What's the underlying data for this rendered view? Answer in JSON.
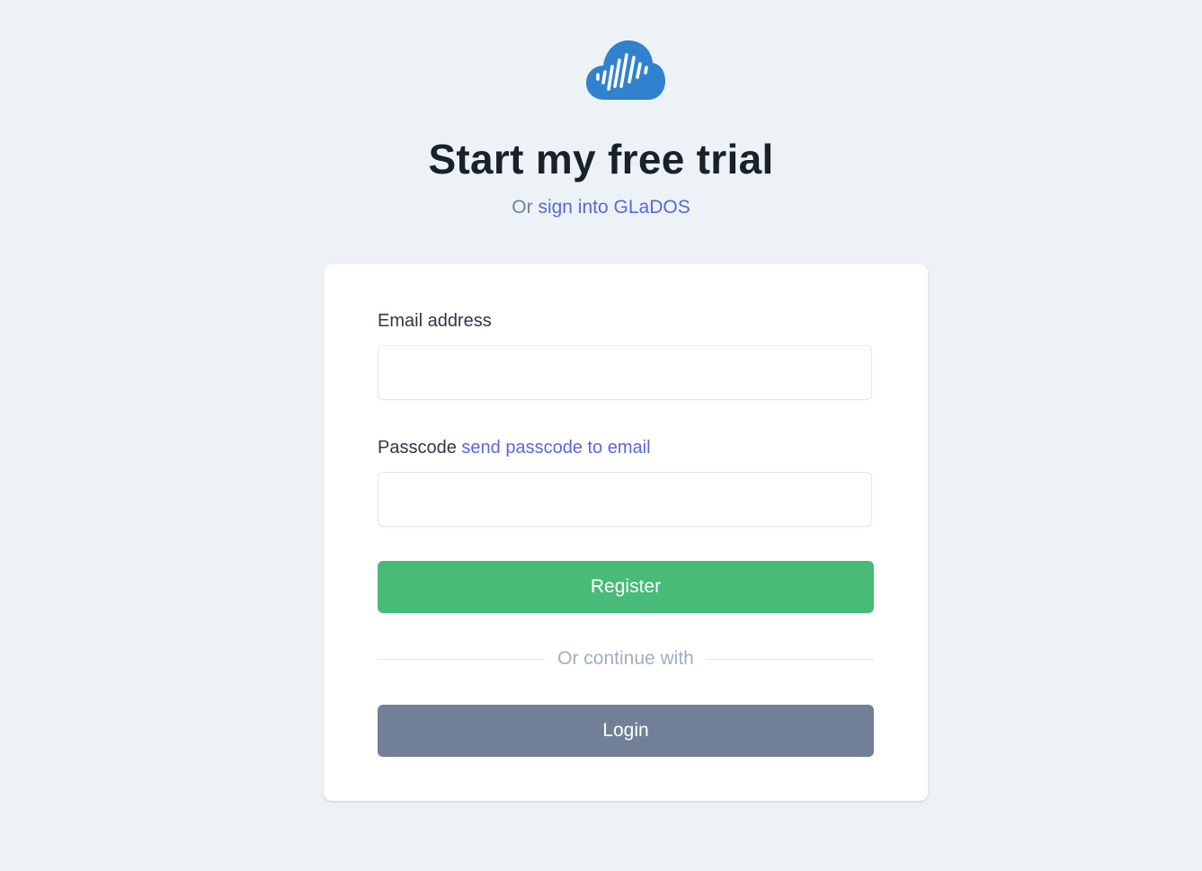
{
  "header": {
    "title": "Start my free trial",
    "subtitle_prefix": "Or",
    "subtitle_link": "sign into GLaDOS"
  },
  "form": {
    "email_label": "Email address",
    "email_value": "",
    "passcode_label": "Passcode",
    "passcode_link": "send passcode to email",
    "passcode_value": "",
    "register_label": "Register",
    "divider_text": "Or continue with",
    "login_label": "Login"
  },
  "colors": {
    "background": "#edf2f7",
    "brand": "#3182ce",
    "link": "#5a67d8",
    "register": "#48bb78",
    "login": "#718096"
  },
  "icons": {
    "logo": "cloud-soundwave-logo"
  }
}
